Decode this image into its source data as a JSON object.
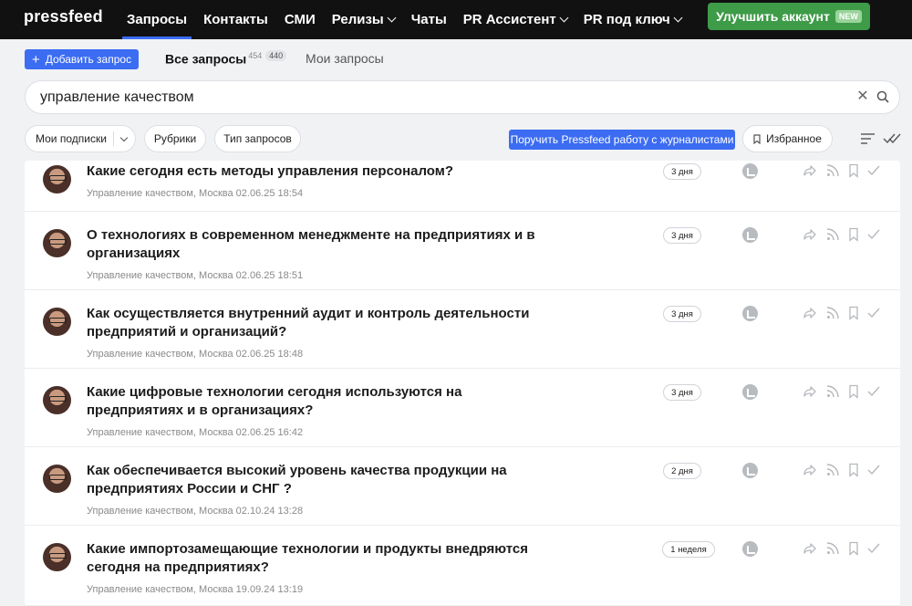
{
  "app": {
    "logo": "pressfeed"
  },
  "nav": {
    "items": [
      {
        "label": "Запросы",
        "active": true,
        "dropdown": false
      },
      {
        "label": "Контакты",
        "active": false,
        "dropdown": false
      },
      {
        "label": "СМИ",
        "active": false,
        "dropdown": false
      },
      {
        "label": "Релизы",
        "active": false,
        "dropdown": true
      },
      {
        "label": "Чаты",
        "active": false,
        "dropdown": false
      },
      {
        "label": "PR Ассистент",
        "active": false,
        "dropdown": true
      },
      {
        "label": "PR под ключ",
        "active": false,
        "dropdown": true
      }
    ],
    "upgrade_label": "Улучшить аккаунт",
    "upgrade_badge": "NEW"
  },
  "toolbar": {
    "add_label": "Добавить запрос",
    "tab_all": "Все запросы",
    "tab_all_count": "454",
    "tab_all_new": "440",
    "tab_my": "Мои запросы"
  },
  "search": {
    "value": "управление качеством",
    "placeholder": ""
  },
  "filters": {
    "subscriptions": "Мои подписки",
    "rubrics": "Рубрики",
    "request_type": "Тип запросов",
    "cta": "Поручить Pressfeed работу с журналистами",
    "favorites": "Избранное"
  },
  "requests": [
    {
      "title_lines": [
        "Какие сегодня есть методы управления персоналом?"
      ],
      "category": "Управление качеством, Москва",
      "date": "02.06.25 18:54",
      "deadline": "3 дня"
    },
    {
      "title_lines": [
        "О технологиях в современном менеджменте на предприятиях и в",
        "организациях"
      ],
      "category": "Управление качеством, Москва",
      "date": "02.06.25 18:51",
      "deadline": "3 дня"
    },
    {
      "title_lines": [
        "Как осуществляется внутренний аудит и контроль деятельности",
        "предприятий и организаций?"
      ],
      "category": "Управление качеством, Москва",
      "date": "02.06.25 18:48",
      "deadline": "3 дня"
    },
    {
      "title_lines": [
        "Какие цифровые технологии сегодня используются на",
        "предприятиях и в организациях?"
      ],
      "category": "Управление качеством, Москва",
      "date": "02.06.25 16:42",
      "deadline": "3 дня"
    },
    {
      "title_lines": [
        "Как обеспечивается высокий уровень качества продукции на",
        "предприятиях России и СНГ ?"
      ],
      "category": "Управление качеством, Москва",
      "date": "02.10.24 13:28",
      "deadline": "2 дня"
    },
    {
      "title_lines": [
        "Какие импортозамещающие технологии и продукты внедряются",
        "сегодня на предприятиях?"
      ],
      "category": "Управление качеством, Москва",
      "date": "19.09.24 13:19",
      "deadline": "1 неделя"
    }
  ],
  "colors": {
    "accent": "#3b6cf2",
    "upgrade": "#3e9b48",
    "topbar": "#111111"
  }
}
